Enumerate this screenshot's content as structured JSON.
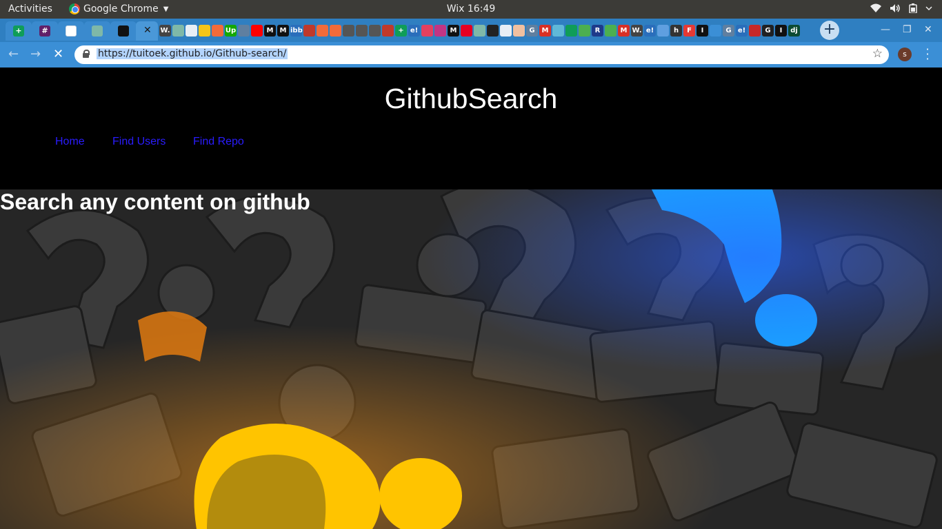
{
  "system": {
    "activities": "Activities",
    "app_name": "Google Chrome",
    "clock": "Wix 16:49"
  },
  "browser": {
    "url": "https://tuitoek.github.io/Github-search/",
    "profile_initial": "s",
    "pinned_tabs": [
      {
        "icon": "google-sheets-icon",
        "glyph": "+",
        "color": "#0f9d58"
      },
      {
        "icon": "slack-icon",
        "glyph": "#",
        "color": "#611f69"
      },
      {
        "icon": "document-icon",
        "glyph": "",
        "color": "#ffffff"
      },
      {
        "icon": "tree-icon",
        "glyph": "",
        "color": "#7fb8a8"
      },
      {
        "icon": "github-icon",
        "glyph": "",
        "color": "#111111"
      }
    ],
    "mini_tabs": [
      {
        "g": "W.",
        "c": "#444444"
      },
      {
        "g": "",
        "c": "#7fb8a8"
      },
      {
        "g": "",
        "c": "#e8eef5"
      },
      {
        "g": "",
        "c": "#f5c518"
      },
      {
        "g": "",
        "c": "#f26b3a"
      },
      {
        "g": "Up",
        "c": "#14a800"
      },
      {
        "g": "",
        "c": "#5f7fa0"
      },
      {
        "g": "",
        "c": "#ff0000"
      },
      {
        "g": "M",
        "c": "#111111"
      },
      {
        "g": "M",
        "c": "#111111"
      },
      {
        "g": "ibb",
        "c": "#2a6ebb"
      },
      {
        "g": "",
        "c": "#c0392b"
      },
      {
        "g": "",
        "c": "#f26b3a"
      },
      {
        "g": "",
        "c": "#f26b3a"
      },
      {
        "g": "",
        "c": "#555555"
      },
      {
        "g": "",
        "c": "#555555"
      },
      {
        "g": "",
        "c": "#555555"
      },
      {
        "g": "",
        "c": "#c0392b"
      },
      {
        "g": "+",
        "c": "#0f9d58"
      },
      {
        "g": "e!",
        "c": "#2a6ebb"
      },
      {
        "g": "",
        "c": "#e4405f"
      },
      {
        "g": "",
        "c": "#c13584"
      },
      {
        "g": "M",
        "c": "#111111"
      },
      {
        "g": "",
        "c": "#e60023"
      },
      {
        "g": "",
        "c": "#7fb8a8"
      },
      {
        "g": "",
        "c": "#222222"
      },
      {
        "g": "",
        "c": "#e8eef5"
      },
      {
        "g": "",
        "c": "#f0c0a0"
      },
      {
        "g": "G",
        "c": "#5f7fa0"
      },
      {
        "g": "M",
        "c": "#d93025"
      },
      {
        "g": "",
        "c": "#5fb8d8"
      },
      {
        "g": "",
        "c": "#0f9d58"
      },
      {
        "g": "",
        "c": "#4caf50"
      },
      {
        "g": "R",
        "c": "#1e3a8a"
      },
      {
        "g": "",
        "c": "#4caf50"
      },
      {
        "g": "M",
        "c": "#d93025"
      },
      {
        "g": "W.",
        "c": "#444444"
      },
      {
        "g": "e!",
        "c": "#2a6ebb"
      },
      {
        "g": "",
        "c": "#5f9fe0"
      },
      {
        "g": "h",
        "c": "#333333"
      },
      {
        "g": "F",
        "c": "#e53935"
      },
      {
        "g": "I",
        "c": "#111111"
      },
      {
        "g": "",
        "c": "#3b8fd6"
      },
      {
        "g": "G",
        "c": "#5f7fa0"
      },
      {
        "g": "e!",
        "c": "#2a6ebb"
      },
      {
        "g": "",
        "c": "#c62828"
      },
      {
        "g": "G",
        "c": "#202124"
      },
      {
        "g": "I",
        "c": "#111111"
      },
      {
        "g": "dj",
        "c": "#0c4b33"
      }
    ]
  },
  "site": {
    "title": "GithubSearch",
    "nav": {
      "home": "Home",
      "find_users": "Find Users",
      "find_repo": "Find Repo"
    },
    "hero_heading": "Search any content on github",
    "hero_image": "question-marks-illustration"
  }
}
